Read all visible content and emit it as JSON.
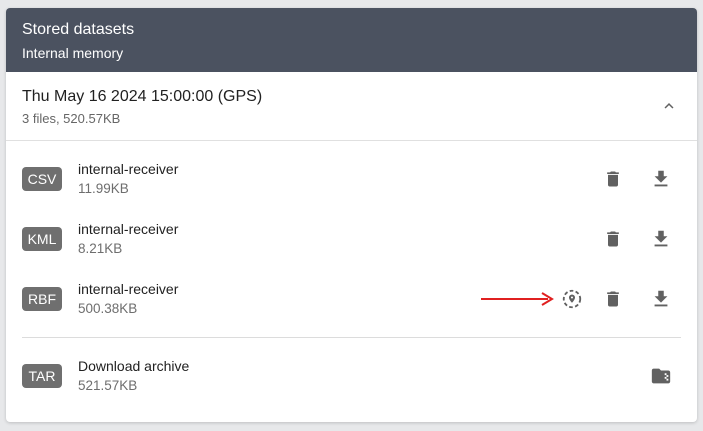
{
  "header": {
    "title": "Stored datasets",
    "subtitle": "Internal memory"
  },
  "section": {
    "title": "Thu May 16 2024 15:00:00 (GPS)",
    "summary": "3 files, 520.57KB",
    "expand_icon": "chevron-up-icon"
  },
  "files": [
    {
      "badge": "CSV",
      "name": "internal-receiver",
      "size": "11.99KB",
      "actions": [
        "delete-icon",
        "download-icon"
      ]
    },
    {
      "badge": "KML",
      "name": "internal-receiver",
      "size": "8.21KB",
      "actions": [
        "delete-icon",
        "download-icon"
      ]
    },
    {
      "badge": "RBF",
      "name": "internal-receiver",
      "size": "500.38KB",
      "actions": [
        "location-icon",
        "delete-icon",
        "download-icon"
      ]
    }
  ],
  "archive": {
    "badge": "TAR",
    "name": "Download archive",
    "size": "521.57KB",
    "action": "archive-folder-icon"
  },
  "annotation": {
    "arrow_color": "#e02020"
  },
  "colors": {
    "header_bg": "#4b5260",
    "badge_bg": "#6f6f6f",
    "icon": "#616161"
  }
}
